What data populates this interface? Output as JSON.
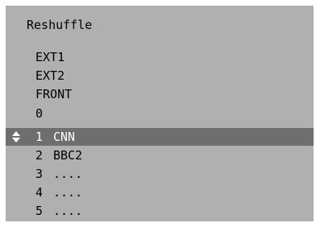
{
  "menu": {
    "title": "Reshuffle",
    "sources": [
      "EXT1",
      "EXT2",
      "FRONT",
      "0"
    ],
    "channels": [
      {
        "number": "1",
        "name": "CNN",
        "selected": true
      },
      {
        "number": "2",
        "name": "BBC2",
        "selected": false
      },
      {
        "number": "3",
        "name": "....",
        "selected": false
      },
      {
        "number": "4",
        "name": "....",
        "selected": false
      },
      {
        "number": "5",
        "name": "....",
        "selected": false
      }
    ],
    "selected_indicator_icon": "up-down-arrows-icon"
  },
  "colors": {
    "panel_background": "#b0b0b0",
    "selection_background": "#6e6e6e",
    "selection_text": "#ffffff",
    "text": "#000000"
  }
}
